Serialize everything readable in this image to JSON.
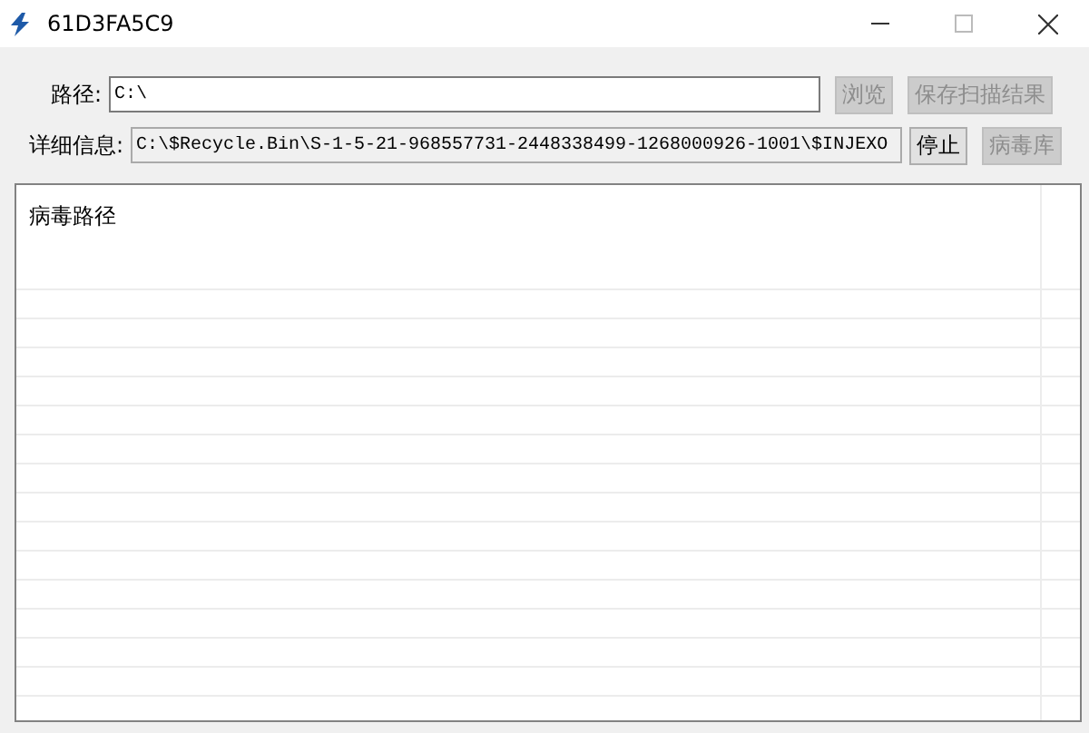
{
  "window": {
    "title": "61D3FA5C9"
  },
  "rows": [
    {
      "label": "路径:",
      "value": "C:\\",
      "readonly": false,
      "buttons": [
        {
          "label": "浏览",
          "disabled": true
        },
        {
          "label": "保存扫描结果",
          "disabled": true
        }
      ]
    },
    {
      "label": "详细信息:",
      "value": "C:\\$Recycle.Bin\\S-1-5-21-968557731-2448338499-1268000926-1001\\$INJEXO",
      "readonly": true,
      "buttons": [
        {
          "label": "停止",
          "disabled": false
        },
        {
          "label": "病毒库",
          "disabled": true
        }
      ]
    }
  ],
  "list": {
    "header": "病毒路径"
  }
}
